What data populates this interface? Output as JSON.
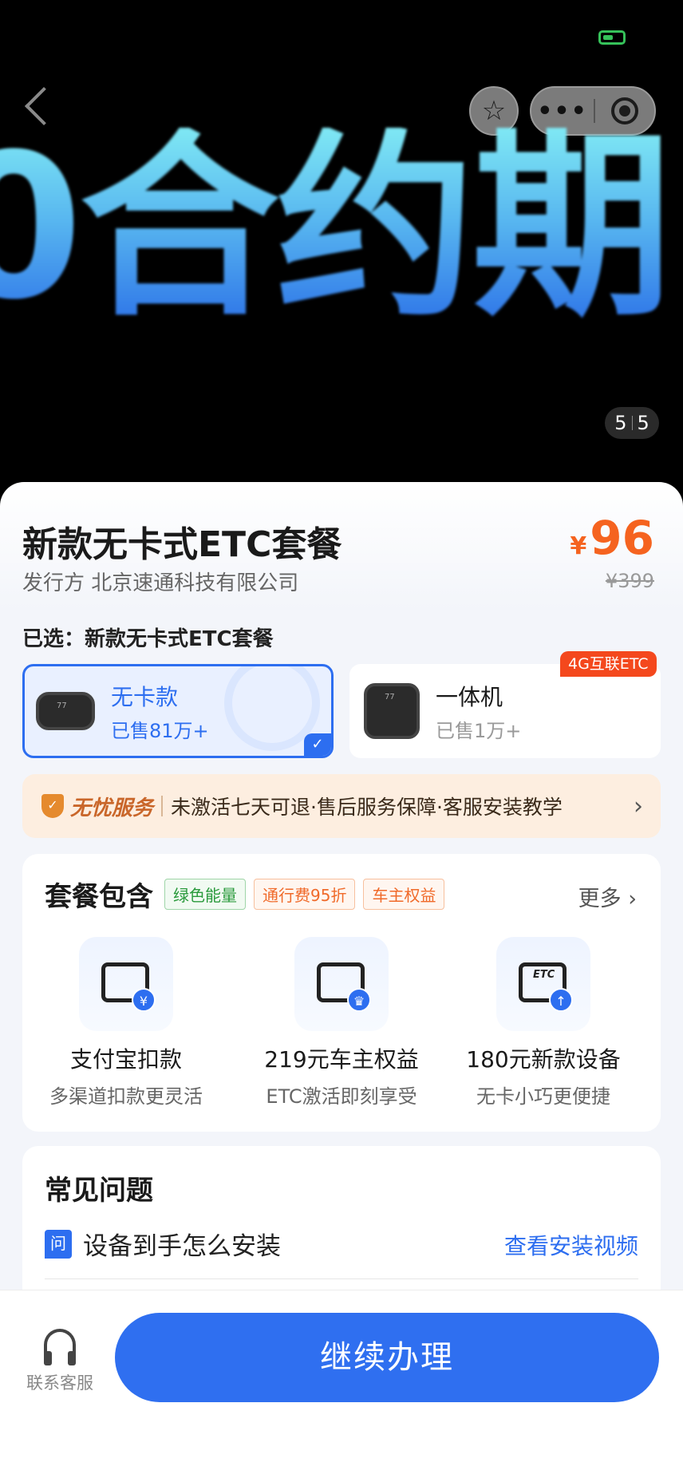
{
  "status": {
    "battery_color": "#36c25a"
  },
  "nav": {
    "star_icon": "☆",
    "more_label": "•••"
  },
  "hero": {
    "text": "0合约期",
    "pager_current": "5",
    "pager_total": "5"
  },
  "product": {
    "title": "新款无卡式ETC套餐",
    "issuer": "发行方 北京速通科技有限公司",
    "price_currency": "¥",
    "price": "96",
    "original_price": "¥399",
    "selected_label": "已选：新款无卡式ETC套餐"
  },
  "options": [
    {
      "name": "无卡款",
      "sold": "已售81万+",
      "selected": true
    },
    {
      "name": "一体机",
      "sold": "已售1万+",
      "tag": "4G互联ETC",
      "selected": false
    }
  ],
  "service": {
    "brand": "无忧服务",
    "desc": "未激活七天可退·售后服务保障·客服安装教学",
    "arrow": "›"
  },
  "package": {
    "heading": "套餐包含",
    "badges": [
      "绿色能量",
      "通行费95折",
      "车主权益"
    ],
    "more": "更多 ›",
    "features": [
      {
        "title": "支付宝扣款",
        "sub": "多渠道扣款更灵活",
        "icon": "alipay-deduct-icon",
        "mark": "¥"
      },
      {
        "title": "219元车主权益",
        "sub": "ETC激活即刻享受",
        "icon": "gift-crown-icon",
        "mark": "♛"
      },
      {
        "title": "180元新款设备",
        "sub": "无卡小巧更便捷",
        "icon": "etc-device-icon",
        "mark": "↑",
        "etc": "ETC"
      }
    ]
  },
  "faq": {
    "heading": "常见问题",
    "q_icon": "问",
    "question": "设备到手怎么安装",
    "link": "查看安装视频"
  },
  "bottom": {
    "service_label": "联系客服",
    "cta": "继续办理"
  },
  "colors": {
    "accent": "#2f6ff0",
    "price": "#f5631f",
    "tag": "#f4481d"
  }
}
